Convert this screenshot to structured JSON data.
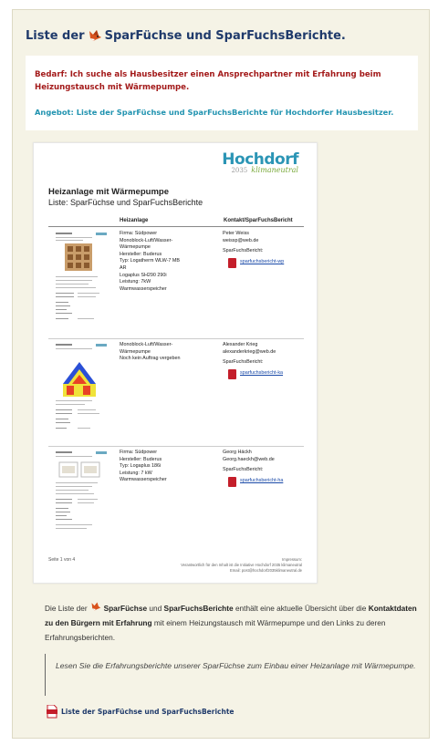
{
  "header": {
    "title_before": "Liste der",
    "title_after": "SparFüchse und SparFuchsBerichte."
  },
  "info": {
    "bedarf": "Bedarf: Ich suche als Hausbesitzer einen Ansprechpartner mit Erfahrung beim Heizungstausch mit Wärmepumpe.",
    "angebot": "Angebot: Liste der SparFüchse und SparFuchsBerichte für Hochdorfer Hausbesitzer."
  },
  "document": {
    "logo": "Hochdorf",
    "logo_year": "2035",
    "logo_sub": "klimaneutral",
    "title": "Heizanlage mit Wärmepumpe",
    "subtitle": "Liste: SparFüchse und SparFuchsBerichte",
    "col_heizanlage": "Heizanlage",
    "col_kontakt": "Kontakt/SparFuchsBericht",
    "entries": [
      {
        "heizanlage": "Firma: Südpower\nMonoblock-Luft/Wasser-\nWärmepumpe\nHersteller: Buderus\nTyp: Logatherm WLW-7 MB\nAR\nLogaplus SH290 290i\nLeistung: 7kW\nWarmwasserspeicher",
        "name": "Peter Weiss",
        "email": "weissp@web.de",
        "bericht_label": "SparFuchsBericht:",
        "link": "sparfuchsbericht-wp"
      },
      {
        "heizanlage": "Monoblock-Luft/Wasser-\nWärmepumpe\nNoch kein Auftrag vergeben",
        "name": "Alexander Krieg",
        "email": "alexanderkrieg@web.de",
        "bericht_label": "SparFuchsBericht:",
        "link": "sparfuchsbericht-ka"
      },
      {
        "heizanlage": "Firma: Südpower\nHersteller: Buderus\nTyp: Logaplus 186i\nLeistung: 7 kW\nWarmwasserspeicher",
        "name": "Georg Häckh",
        "email": "Georg.haeckh@web.de",
        "bericht_label": "SparFuchsBericht:",
        "link": "sparfuchsbericht-ha"
      }
    ],
    "footer_left": "Seite 1 von 4",
    "footer_right": "Impressum:\nVerantwortlich für den Inhalt ist die Initiative Hochdorf 2035 klimaneutral\nEmail: post@hochdorf2035klimaneutral.de"
  },
  "description": {
    "p1": "Die Liste der",
    "b1": "SparFüchse",
    "p2": "und",
    "b2": "SparFuchsBerichte",
    "p3": "enthält eine aktuelle Übersicht über die",
    "b3": "Kontaktdaten zu den Bürgern mit Erfahrung",
    "p4": "mit einem Heizungstausch mit Wärmepumpe und den Links zu deren Erfahrungsberichten."
  },
  "quote": "Lesen Sie die Erfahrungsberichte unserer SparFüchse zum Einbau einer Heizanlage mit Wärmepumpe.",
  "pdf_link": "Liste der SparFüchse und SparFuchsBerichte",
  "colors": {
    "title": "#1f3a6b",
    "bedarf": "#a31a1a",
    "angebot": "#2193b0",
    "card_bg": "#f5f3e6"
  }
}
